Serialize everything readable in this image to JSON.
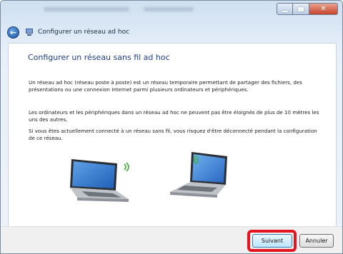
{
  "window": {
    "nav_title": "Configurer un réseau ad hoc",
    "controls": {
      "minimize": "minimize-icon",
      "maximize": "maximize-icon",
      "close": "✕"
    }
  },
  "content": {
    "heading": "Configurer un réseau sans fil ad hoc",
    "paragraph1": "Un réseau ad hoc (réseau poste à poste) est un réseau temporaire permettant de partager des fichiers, des présentations ou une connexion Internet parmi plusieurs ordinateurs et périphériques.",
    "paragraph2": "Les ordinateurs et les périphériques dans un réseau ad hoc ne peuvent pas être éloignés de plus de 10 mètres les uns des autres.",
    "paragraph3": "Si vous êtes actuellement connecté à un réseau sans fil, vous risquez d'être déconnecté pendant la configuration de ce réseau."
  },
  "footer": {
    "next_label": "Suivant",
    "cancel_label": "Annuler"
  },
  "colors": {
    "heading": "#1e3c8c",
    "highlight": "#e3151e",
    "wifi": "#3fae3b"
  }
}
